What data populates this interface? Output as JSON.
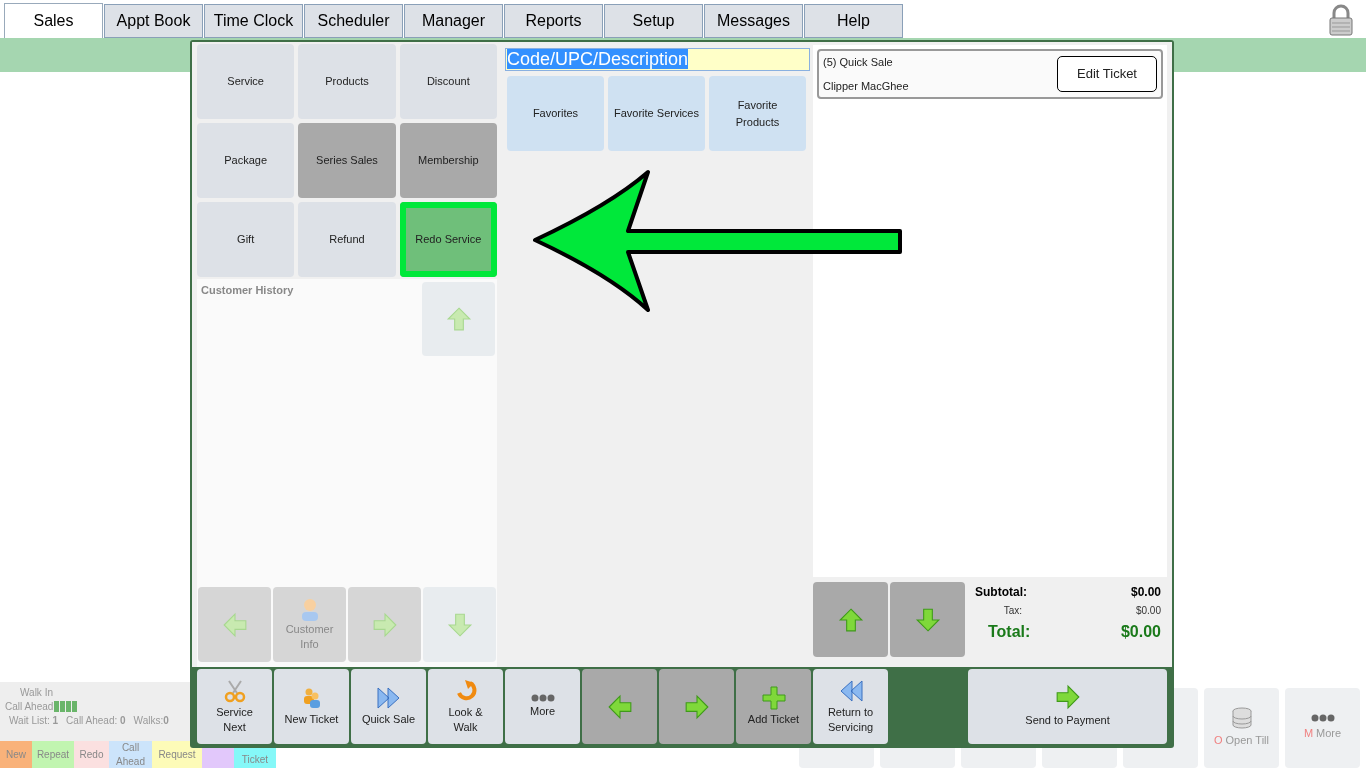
{
  "tabs": [
    {
      "label": "Sales",
      "selected": true
    },
    {
      "label": "Appt Book",
      "selected": false
    },
    {
      "label": "Time Clock",
      "selected": false
    },
    {
      "label": "Scheduler",
      "selected": false
    },
    {
      "label": "Manager",
      "selected": false
    },
    {
      "label": "Reports",
      "selected": false
    },
    {
      "label": "Setup",
      "selected": false
    },
    {
      "label": "Messages",
      "selected": false
    },
    {
      "label": "Help",
      "selected": false
    }
  ],
  "queue_panel": {
    "walk_in": "Walk In",
    "call_ahead": "Call Ahead",
    "stats": [
      "Wait List: **1**",
      "Call Ahead: **0**",
      "Walks:**0**"
    ],
    "legend": [
      {
        "label": "New",
        "color": "#f9b27a"
      },
      {
        "label": "Repeat",
        "color": "#c1f5b0"
      },
      {
        "label": "Redo",
        "color": "#fbe0e0"
      },
      {
        "label": "Call Ahead",
        "color": "#cce4fb"
      },
      {
        "label": "Request",
        "color": "#fdfbb8"
      },
      {
        "color": "#e2c8fb"
      },
      {
        "label": "Ticket",
        "color": "#85f8f8"
      }
    ]
  },
  "background_buttons": [
    {
      "label": "Open Till",
      "hotkey": "O"
    },
    {
      "label": "More",
      "hotkey": "M"
    }
  ],
  "category_buttons": [
    {
      "label": "Service",
      "kind": "light"
    },
    {
      "label": "Products",
      "kind": "light"
    },
    {
      "label": "Discount",
      "kind": "light"
    },
    {
      "label": "Package",
      "kind": "light"
    },
    {
      "label": "Series Sales",
      "kind": "dark"
    },
    {
      "label": "Membership",
      "kind": "dark"
    },
    {
      "label": "Gift",
      "kind": "light"
    },
    {
      "label": "Refund",
      "kind": "light"
    },
    {
      "label": "Redo Service",
      "kind": "highlighted"
    }
  ],
  "search_field": {
    "value": "Code/UPC/Description",
    "selected": true
  },
  "favorite_buttons": [
    "Favorites",
    "Favorite Services",
    "Favorite Products"
  ],
  "customer_history": {
    "title": "Customer History",
    "nav_buttons": [
      {
        "kind": "left"
      },
      {
        "kind": "customer",
        "label": "Customer Info"
      },
      {
        "kind": "right"
      },
      {
        "kind": "down"
      }
    ]
  },
  "ticket": {
    "title": "(5) Quick Sale",
    "customer": "Clipper MacGhee",
    "edit_button": "Edit Ticket"
  },
  "totals": {
    "subtotal_label": "Subtotal:",
    "subtotal": "$0.00",
    "tax_label": "Tax:",
    "tax": "$0.00",
    "total_label": "Total:",
    "total": "$0.00"
  },
  "toolbar": [
    {
      "lines": [
        "Service",
        "Next"
      ],
      "dark": false
    },
    {
      "lines": [
        "New Ticket"
      ],
      "dark": false
    },
    {
      "lines": [
        "Quick Sale"
      ],
      "dark": false
    },
    {
      "lines": [
        "Look &",
        "Walk"
      ],
      "dark": false
    },
    {
      "lines": [
        "More"
      ],
      "dark": false
    },
    {
      "dark": true
    },
    {
      "dark": true
    },
    {
      "lines": [
        "Add Ticket"
      ],
      "dark": true
    },
    {
      "lines": [
        "Return to",
        "Servicing"
      ],
      "dark": false
    }
  ],
  "payment_button": {
    "label": "Send to Payment"
  }
}
